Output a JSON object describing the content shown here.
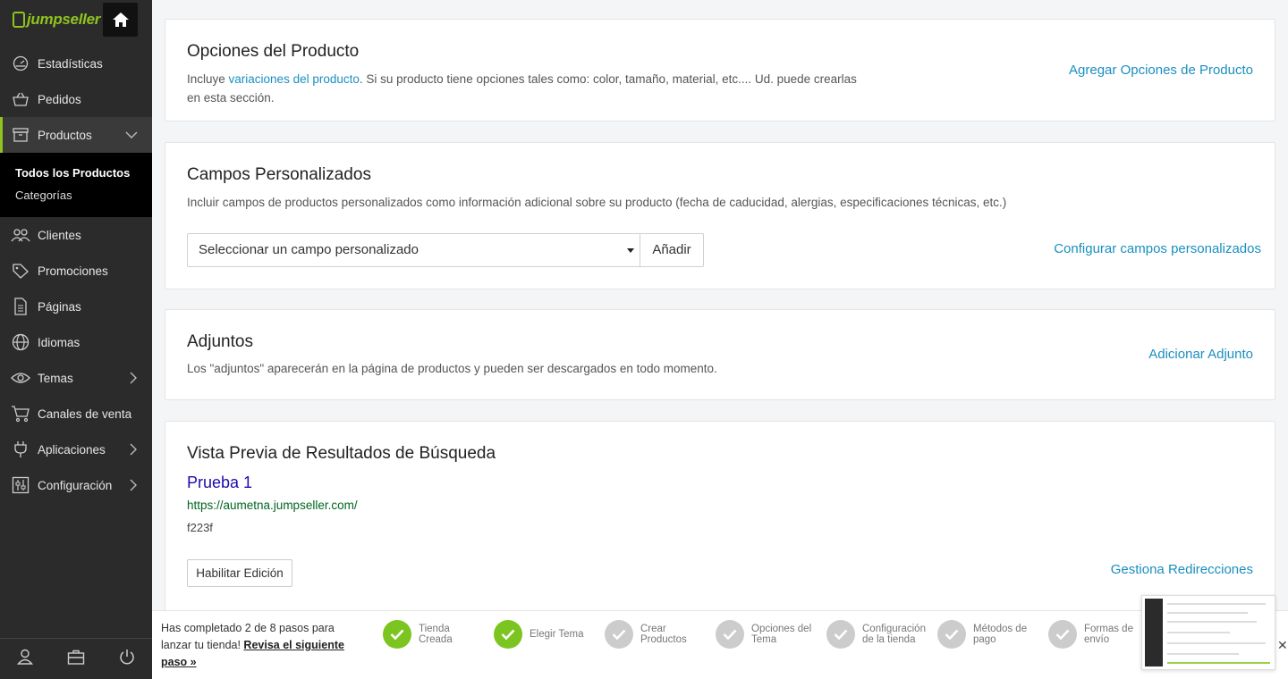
{
  "sidebar": {
    "logo": "jumpseller",
    "items": [
      {
        "label": "Estadísticas",
        "icon": "speedometer-icon"
      },
      {
        "label": "Pedidos",
        "icon": "basket-icon"
      },
      {
        "label": "Productos",
        "icon": "box-icon"
      },
      {
        "label": "Clientes",
        "icon": "users-icon"
      },
      {
        "label": "Promociones",
        "icon": "tag-icon"
      },
      {
        "label": "Páginas",
        "icon": "document-icon"
      },
      {
        "label": "Idiomas",
        "icon": "globe-icon"
      },
      {
        "label": "Temas",
        "icon": "eye-icon"
      },
      {
        "label": "Canales de venta",
        "icon": "cart-icon"
      },
      {
        "label": "Aplicaciones",
        "icon": "plug-icon"
      },
      {
        "label": "Configuración",
        "icon": "sliders-icon"
      }
    ],
    "submenu": [
      "Todos los Productos",
      "Categorías"
    ]
  },
  "cards": {
    "options": {
      "title": "Opciones del Producto",
      "desc_prefix": "Incluye ",
      "desc_link": "variaciones del producto",
      "desc_suffix": ". Si su producto tiene opciones tales como: color, tamaño, material, etc.... Ud. puede crearlas en esta sección.",
      "action": "Agregar Opciones de Producto"
    },
    "custom_fields": {
      "title": "Campos Personalizados",
      "desc": "Incluir campos de productos personalizados como información adicional sobre su producto (fecha de caducidad, alergias, especificaciones técnicas, etc.)",
      "select_value": "Seleccionar un campo personalizado",
      "add_button": "Añadir",
      "action": "Configurar campos personalizados"
    },
    "attachments": {
      "title": "Adjuntos",
      "desc": "Los \"adjuntos\" aparecerán en la página de productos y pueden ser descargados en todo momento.",
      "action": "Adicionar Adjunto"
    },
    "seo": {
      "title": "Vista Previa de Resultados de Búsqueda",
      "result_title": "Prueba 1",
      "result_url": "https://aumetna.jumpseller.com/",
      "result_desc": "f223f",
      "edit_button": "Habilitar Edición",
      "action": "Gestiona Redirecciones"
    }
  },
  "onboarding": {
    "text": "Has completado 2 de 8 pasos para lanzar tu tienda! ",
    "cta": "Revisa el siguiente paso »",
    "steps": [
      {
        "label": "Tienda Creada",
        "done": true
      },
      {
        "label": "Elegir Tema",
        "done": true
      },
      {
        "label": "Crear Productos",
        "done": false
      },
      {
        "label": "Opciones del Tema",
        "done": false
      },
      {
        "label": "Configuración de la tienda",
        "done": false
      },
      {
        "label": "Métodos de pago",
        "done": false
      },
      {
        "label": "Formas de envío",
        "done": false
      }
    ]
  },
  "colors": {
    "accent": "#8cb81a",
    "sidebar": "#2b2b2b",
    "step_done": "#7cc520"
  }
}
